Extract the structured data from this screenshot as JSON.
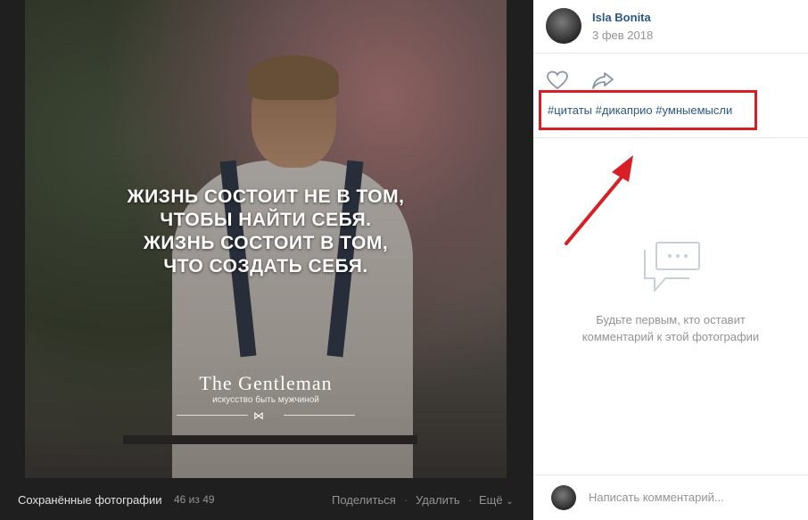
{
  "photo": {
    "quote_lines": [
      "ЖИЗНЬ СОСТОИТ НЕ В ТОМ,",
      "ЧТОБЫ НАЙТИ СЕБЯ.",
      "ЖИЗНЬ СОСТОИТ В ТОМ,",
      "ЧТО СОЗДАТЬ СЕБЯ."
    ],
    "brand": "The Gentleman",
    "brand_sub": "искусство быть мужчиной"
  },
  "viewer_bar": {
    "album_title": "Сохранённые фотографии",
    "counter": "46 из 49",
    "share_label": "Поделиться",
    "delete_label": "Удалить",
    "more_label": "Ещё",
    "dot": "·"
  },
  "post": {
    "author": "Isla Bonita",
    "date": "3 фев 2018",
    "hashtags": [
      "#цитаты",
      "#дикаприо",
      "#умныемысли"
    ]
  },
  "comments": {
    "empty_line1": "Будьте первым, кто оставит",
    "empty_line2": "комментарий к этой фотографии",
    "input_placeholder": "Написать комментарий..."
  },
  "colors": {
    "link": "#2a5885",
    "highlight": "#d81f26",
    "viewer_bg": "#1f1f1f"
  }
}
